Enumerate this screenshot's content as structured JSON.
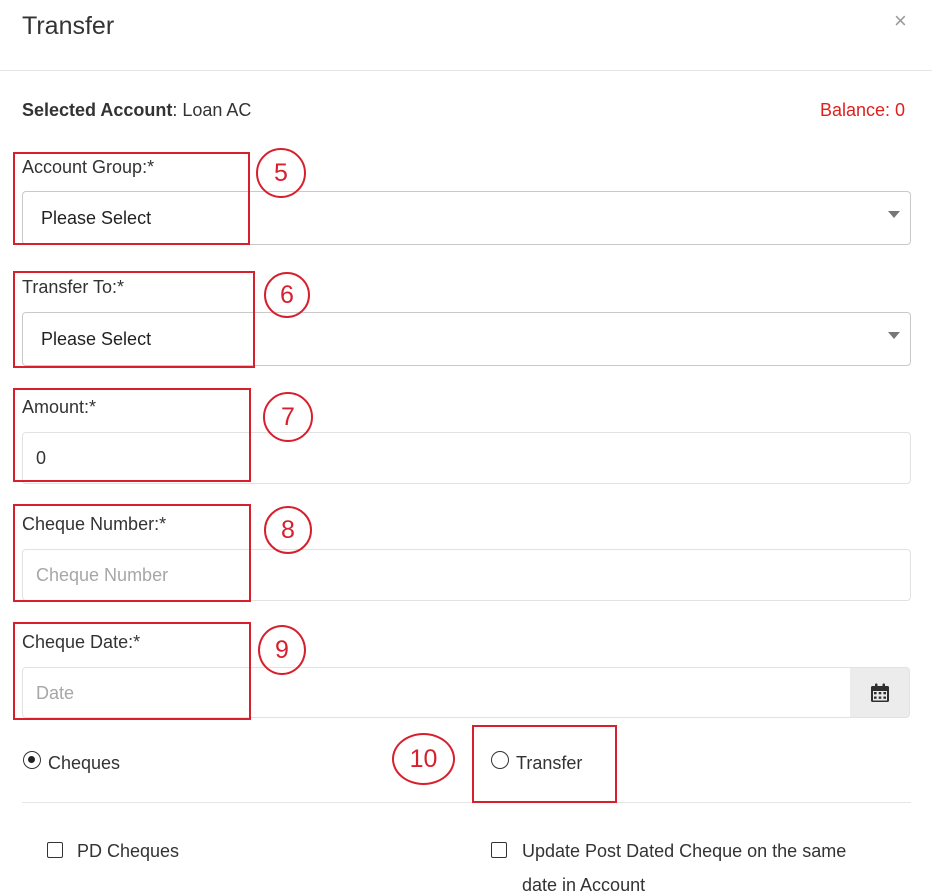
{
  "modal": {
    "title": "Transfer",
    "close_label": "×"
  },
  "account": {
    "selected_label": "Selected Account",
    "selected_value": ": Loan AC",
    "balance": "Balance: 0"
  },
  "fields": {
    "account_group": {
      "label": "Account Group:*",
      "value": "Please Select"
    },
    "transfer_to": {
      "label": "Transfer To:*",
      "value": "Please Select"
    },
    "amount": {
      "label": "Amount:*",
      "value": "0"
    },
    "cheque_number": {
      "label": "Cheque Number:*",
      "placeholder": "Cheque Number"
    },
    "cheque_date": {
      "label": "Cheque Date:*",
      "placeholder": "Date"
    }
  },
  "payment_mode": {
    "options": [
      {
        "label": "Cheques",
        "selected": true
      },
      {
        "label": "Transfer",
        "selected": false
      }
    ]
  },
  "options": {
    "pd_cheques": {
      "label": "PD Cheques",
      "checked": false
    },
    "update_post_dated": {
      "label": "Update Post Dated Cheque on the same",
      "label_cont": "date in Account",
      "checked": false
    }
  },
  "annotations": [
    "5",
    "6",
    "7",
    "8",
    "9",
    "10"
  ],
  "colors": {
    "annotation": "#d7202d",
    "balance": "#e02020"
  },
  "icons": {
    "close": "close-icon",
    "calendar": "calendar-icon",
    "caret": "chevron-down-icon"
  }
}
